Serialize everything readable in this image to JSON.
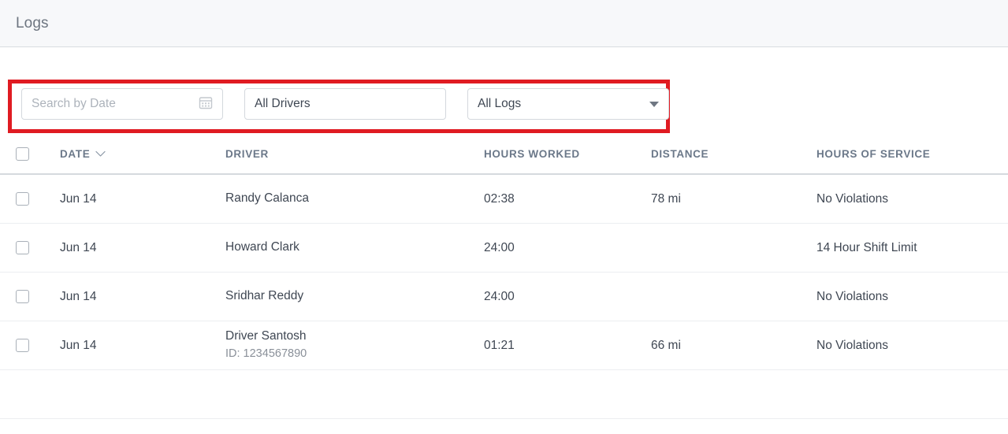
{
  "header": {
    "title": "Logs"
  },
  "filters": {
    "date": {
      "placeholder": "Search by Date",
      "value": "",
      "icon": "calendar-icon"
    },
    "driver": {
      "value": "All Drivers",
      "placeholder": "All Drivers"
    },
    "log_type": {
      "value": "All Logs",
      "icon": "caret-down-icon"
    },
    "highlight_color": "#e01b22"
  },
  "table": {
    "columns": [
      {
        "key": "select",
        "label": ""
      },
      {
        "key": "date",
        "label": "DATE",
        "sort_icon": "chevron-down-icon"
      },
      {
        "key": "driver",
        "label": "DRIVER"
      },
      {
        "key": "hours_worked",
        "label": "HOURS WORKED"
      },
      {
        "key": "distance",
        "label": "DISTANCE"
      },
      {
        "key": "hours_of_service",
        "label": "HOURS OF SERVICE"
      }
    ],
    "rows": [
      {
        "date": "Jun 14",
        "driver": "Randy Calanca",
        "driver_id": "",
        "hours_worked": "02:38",
        "distance": "78 mi",
        "hours_of_service": "No Violations",
        "violation": false
      },
      {
        "date": "Jun 14",
        "driver": "Howard Clark",
        "driver_id": "",
        "hours_worked": "24:00",
        "distance": "",
        "hours_of_service": "14 Hour Shift Limit",
        "violation": true
      },
      {
        "date": "Jun 14",
        "driver": "Sridhar Reddy",
        "driver_id": "",
        "hours_worked": "24:00",
        "distance": "",
        "hours_of_service": "No Violations",
        "violation": false
      },
      {
        "date": "Jun 14",
        "driver": "Driver Santosh",
        "driver_id": "ID: 1234567890",
        "hours_worked": "01:21",
        "distance": "66 mi",
        "hours_of_service": "No Violations",
        "violation": false
      }
    ],
    "violation_color": "#d6464b"
  }
}
